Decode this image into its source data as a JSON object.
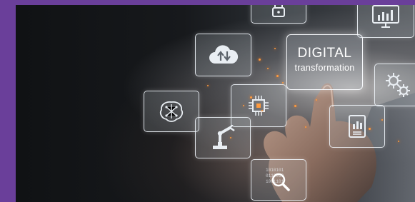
{
  "digital_tile": {
    "title": "DIGITAL",
    "subtitle": "transformation"
  },
  "icons": [
    "lock-icon",
    "monitor-chart-icon",
    "cloud-upload-download-icon",
    "circuit-brain-icon",
    "chip-icon",
    "robot-arm-icon",
    "gears-icon",
    "document-chart-icon",
    "binary-magnifier-icon"
  ],
  "colors": {
    "frame": "#6a3f9a",
    "background": "#17191c",
    "sparks": "#ff9a3d"
  }
}
